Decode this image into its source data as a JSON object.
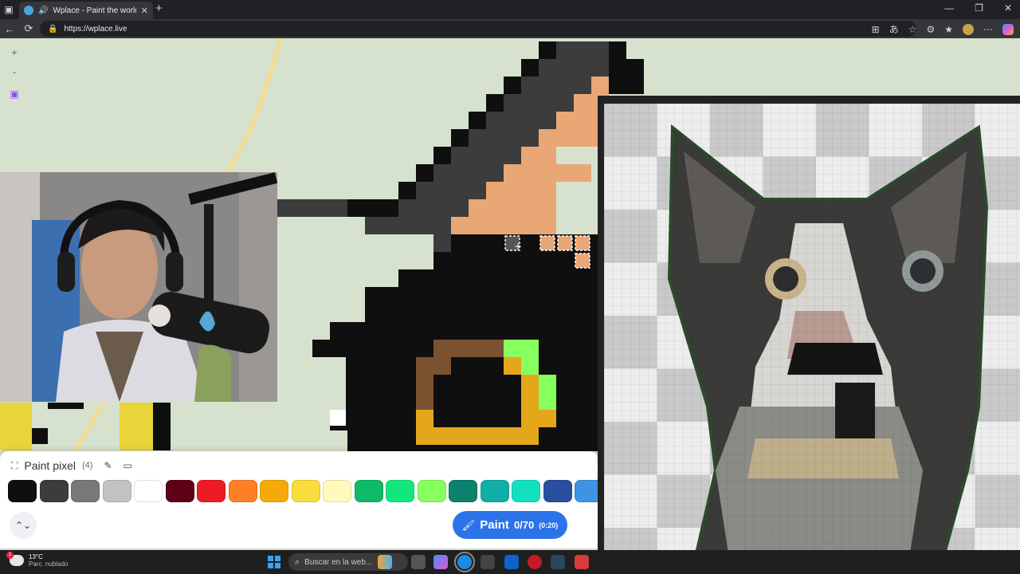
{
  "browser": {
    "tab_title": "Wplace - Paint the world",
    "url": "https://wplace.live",
    "new_tab_icon": "plus-icon"
  },
  "map": {
    "zoom_in": "+",
    "zoom_out": "-"
  },
  "paint_panel": {
    "title": "Paint pixel",
    "count": "(4)",
    "paint_label": "Paint",
    "progress": "0/70",
    "timer": "(0:20)",
    "palette": [
      "#0f0f0f",
      "#3c3c3c",
      "#787878",
      "#c2c2c2",
      "#ffffff",
      "#600018",
      "#ed1c24",
      "#ff7f27",
      "#f6aa09",
      "#f9dd3b",
      "#fffabc",
      "#0eb968",
      "#13e67b",
      "#87ff5e",
      "#0c816e",
      "#10aea6",
      "#13e1be",
      "#28509e",
      "#4093e4"
    ]
  },
  "taskbar": {
    "temperature": "13°C",
    "condition": "Parc. nublado",
    "search_placeholder": "Buscar en la web...",
    "weather_badge": "1"
  },
  "colors": {
    "accent": "#2c73ea",
    "map_bg": "#d6e2cd",
    "peach": "#e8a775",
    "dark_gray": "#3c3c3c",
    "gold": "#e4a71c",
    "brown": "#7a5230",
    "green": "#87ff5e"
  }
}
